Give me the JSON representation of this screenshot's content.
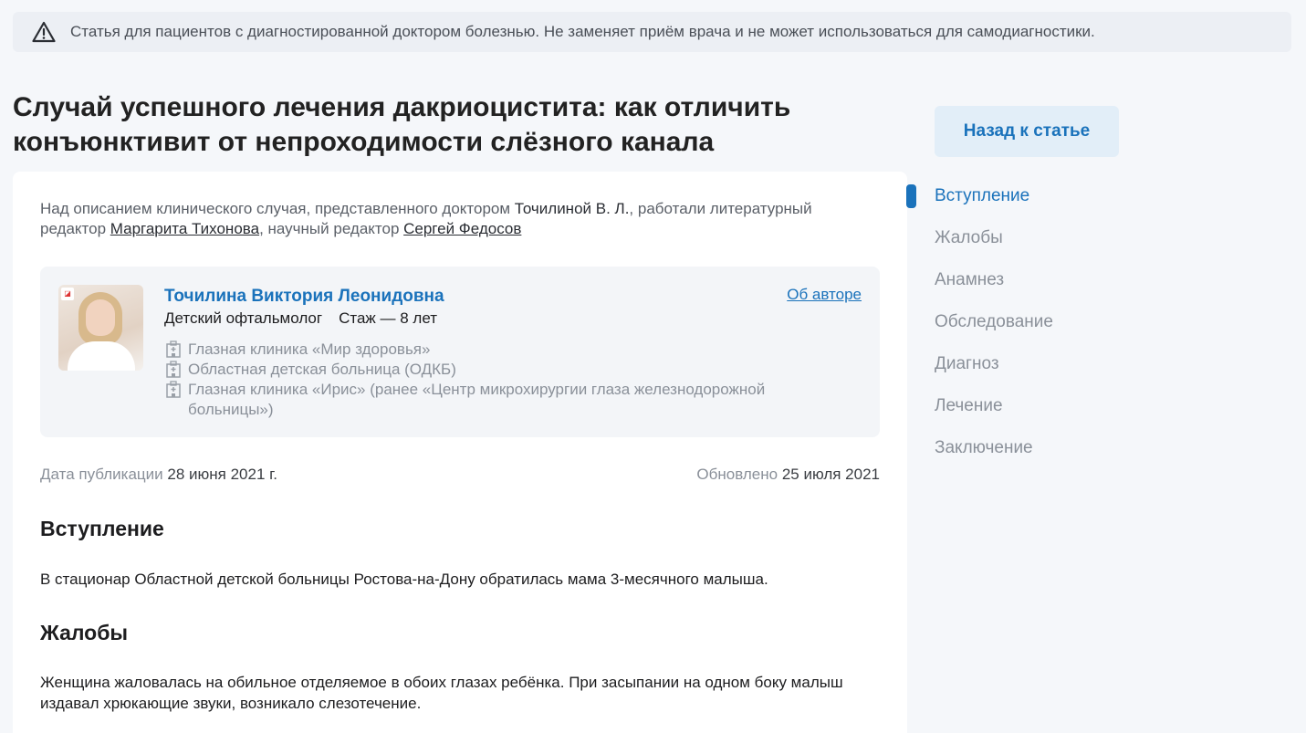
{
  "notice": {
    "icon": "warning-icon",
    "text": "Статья для пациентов с диагностированной доктором болезнью. Не заменяет приём врача и не может использоваться для самодиагностики."
  },
  "article": {
    "title": "Случай успешного лечения дакриоцистита: как отличить конъюнктивит от непроходимости слёзного канала",
    "editors": {
      "prefix": "Над описанием клинического случая, представленного доктором ",
      "doctor": "Точилиной В. Л.",
      "middle": ", работали литературный редактор ",
      "lit_editor": "Маргарита Тихонова",
      "sci_prefix": ", научный редактор ",
      "sci_editor": "Сергей Федосов"
    },
    "author": {
      "name": "Точилина Виктория Леонидовна",
      "about_link": "Об авторе",
      "role": "Детский офтальмолог",
      "experience": "Стаж — 8 лет",
      "clinics": [
        "Глазная клиника «Мир здоровья»",
        "Областная детская больница (ОДКБ)",
        "Глазная клиника «Ирис» (ранее «Центр микрохирургии глаза железнодорожной больницы»)"
      ]
    },
    "published_label": "Дата публикации",
    "published_date": "28 июня 2021 г.",
    "updated_label": "Обновлено",
    "updated_date": "25 июля 2021",
    "sections": [
      {
        "heading": "Вступление",
        "text": "В стационар Областной детской больницы Ростова-на-Дону обратилась мама 3-месячного малыша."
      },
      {
        "heading": "Жалобы",
        "text": "Женщина жаловалась на обильное отделяемое в обоих глазах ребёнка. При засыпании на одном боку малыш издавал хрюкающие звуки, возникало слезотечение."
      }
    ]
  },
  "sidebar": {
    "back_button": "Назад к статье",
    "toc": [
      {
        "label": "Вступление",
        "active": true
      },
      {
        "label": "Жалобы",
        "active": false
      },
      {
        "label": "Анамнез",
        "active": false
      },
      {
        "label": "Обследование",
        "active": false
      },
      {
        "label": "Диагноз",
        "active": false
      },
      {
        "label": "Лечение",
        "active": false
      },
      {
        "label": "Заключение",
        "active": false
      }
    ]
  },
  "colors": {
    "accent": "#1a72bb",
    "muted": "#8a9099",
    "background": "#f5f7fa"
  }
}
